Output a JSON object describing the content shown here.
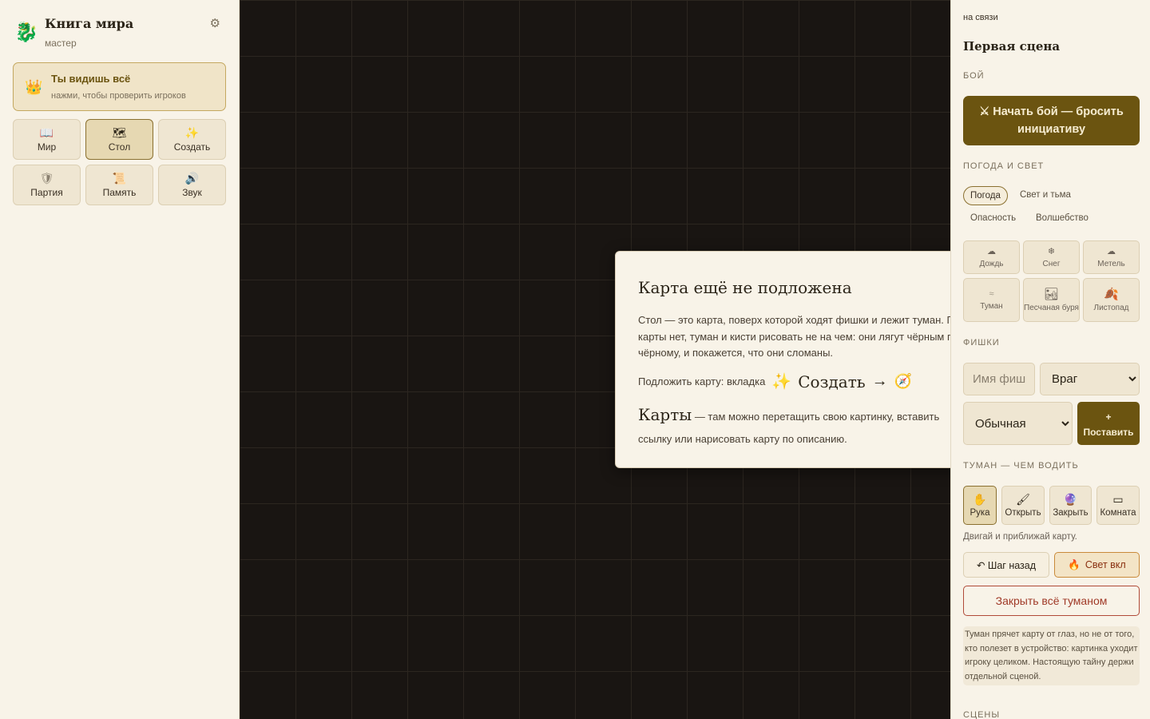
{
  "brand": {
    "logo_icon": "dragon-icon",
    "title": "Книга мира",
    "subtitle": "мастер",
    "settings_icon": "gear-icon"
  },
  "see_all": {
    "icon": "crown-icon",
    "title": "Ты видишь всё",
    "hint": "нажми, чтобы проверить игроков"
  },
  "nav": [
    {
      "icon": "book-icon",
      "label": "Мир",
      "active": false
    },
    {
      "icon": "map-icon",
      "label": "Стол",
      "active": true
    },
    {
      "icon": "sparkles-icon",
      "label": "Создать",
      "active": false
    },
    {
      "icon": "shield-icon",
      "label": "Партия",
      "active": false
    },
    {
      "icon": "scroll-icon",
      "label": "Память",
      "active": false
    },
    {
      "icon": "speaker-icon",
      "label": "Звук",
      "active": false
    }
  ],
  "notice": {
    "title": "Карта ещё не подложена",
    "body": "Стол — это карта, поверх которой ходят фишки и лежит туман. Пока карты нет, туман и кисти рисовать не на чем: они лягут чёрным по чёрному, и покажется, что они сломаны.",
    "hint_prefix": "Подложить карту: вкладка",
    "hint_tab": "Создать",
    "hint_arrow": "→",
    "hint_section": "Карты",
    "hint_suffix": "— там можно перетащить свою картинку, вставить ссылку или нарисовать карту по описанию."
  },
  "right": {
    "status": "на связи",
    "scene_title": "Первая сцена",
    "fight_header": "Бой",
    "fight_button": "⚔ Начать бой — бросить инициативу",
    "weather_header": "Погода и свет",
    "weather_tabs": [
      "Погода",
      "Свет и тьма",
      "Опасность",
      "Волшебство"
    ],
    "weather_effects": [
      {
        "icon": "rain-cloud-icon",
        "label": "Дождь"
      },
      {
        "icon": "snowflake-icon",
        "label": "Снег"
      },
      {
        "icon": "blizzard-cloud-icon",
        "label": "Метель"
      },
      {
        "icon": "fog-icon",
        "label": "Туман"
      },
      {
        "icon": "sandstorm-icon",
        "label": "Песчаная буря"
      },
      {
        "icon": "leaf-icon",
        "label": "Листопад"
      }
    ],
    "tokens_header": "Фишки",
    "token_name_placeholder": "Имя фишки",
    "token_kind": "Враг",
    "token_size": "Обычная",
    "place_button_plus": "+",
    "place_button": "Поставить",
    "fog_header": "Туман — чем водить",
    "fog_tools": [
      {
        "icon": "hand-icon",
        "label": "Рука",
        "active": true
      },
      {
        "icon": "brush-icon",
        "label": "Открыть",
        "active": false
      },
      {
        "icon": "orb-icon",
        "label": "Закрыть",
        "active": false
      },
      {
        "icon": "room-icon",
        "label": "Комната",
        "active": false
      }
    ],
    "fog_hint": "Двигай и приближай карту.",
    "undo_button": "↶ Шаг назад",
    "light_button": "Свет вкл",
    "close_all_button": "Закрыть всё туманом",
    "fog_note": "Туман прячет карту от глаз, но не от того, кто полезет в устройство: картинка уходит игроку целиком. Настоящую тайну держи отдельной сценой.",
    "scenes_header": "Сцены"
  },
  "colors": {
    "accent": "#6b5410",
    "danger": "#a03a28",
    "canvas": "#191512",
    "panel": "#f8f3e8"
  }
}
